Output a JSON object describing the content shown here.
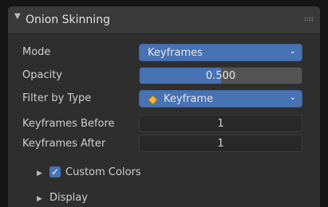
{
  "panel": {
    "title": "Onion Skinning",
    "collapse_icon": "triangle-down-icon",
    "grip_icon": "drag-grip-icon"
  },
  "rows": {
    "mode": {
      "label": "Mode",
      "value": "Keyframes"
    },
    "opacity": {
      "label": "Opacity",
      "value": "0.500",
      "fraction": 0.5
    },
    "filter": {
      "label": "Filter by Type",
      "value": "Keyframe",
      "icon": "keyframe-diamond-icon"
    },
    "before": {
      "label": "Keyframes Before",
      "value": "1"
    },
    "after": {
      "label": "Keyframes After",
      "value": "1"
    }
  },
  "subpanels": {
    "custom_colors": {
      "label": "Custom Colors",
      "checked": true
    },
    "display": {
      "label": "Display"
    }
  },
  "colors": {
    "accent": "#4772b3",
    "keyframe": "#f5b93c",
    "panel_bg": "#2e2e2e",
    "header_bg": "#3a3a3a"
  }
}
